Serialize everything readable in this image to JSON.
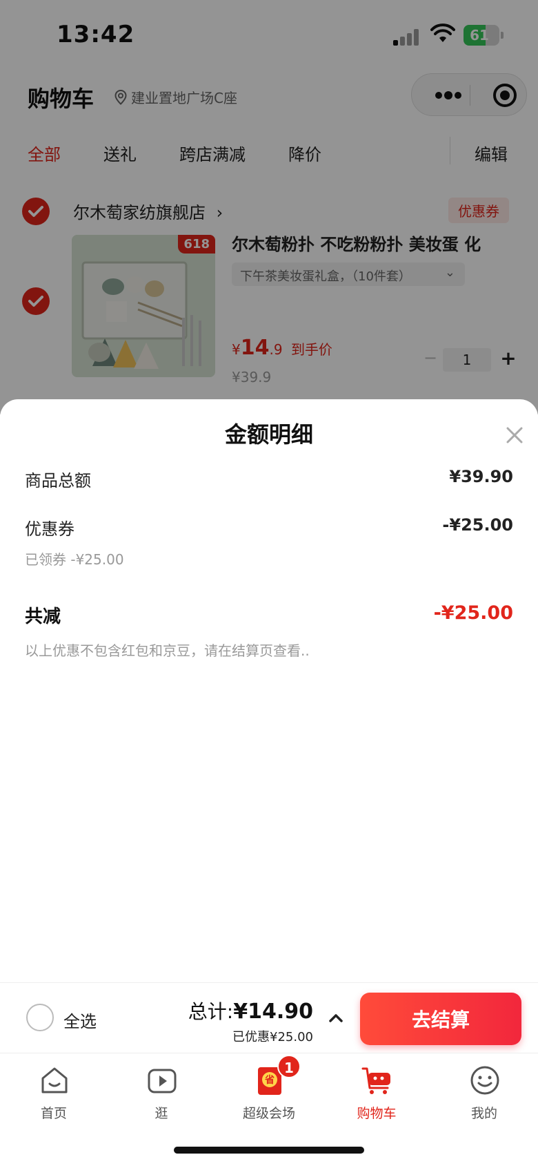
{
  "status_bar": {
    "time": "13:42",
    "battery": "61"
  },
  "header": {
    "title": "购物车",
    "location": "建业置地广场C座"
  },
  "tabs": [
    {
      "label": "全部",
      "active": true
    },
    {
      "label": "送礼",
      "active": false
    },
    {
      "label": "跨店满减",
      "active": false
    },
    {
      "label": "降价",
      "active": false
    }
  ],
  "edit_label": "编辑",
  "shop": {
    "name": "尔木萄家纺旗舰店",
    "coupon_label": "优惠券"
  },
  "item": {
    "badge": "618",
    "title": "尔木萄粉扑 不吃粉粉扑 美妆蛋 化",
    "spec": "下午茶美妆蛋礼盒，（10件套）",
    "price_currency": "¥",
    "price_int": "14",
    "price_dec": ".9",
    "price_suffix": "到手价",
    "original_price": "¥39.9",
    "quantity": "1",
    "minus": "−",
    "plus": "+"
  },
  "sheet": {
    "title": "金额明细",
    "rows": [
      {
        "label": "商品总额",
        "value": "¥39.90"
      },
      {
        "label": "优惠券",
        "value": "-¥25.00",
        "sub": "已领券 -¥25.00"
      }
    ],
    "total": {
      "label": "共减",
      "value": "-¥25.00"
    },
    "note": "以上优惠不包含红包和京豆，请在结算页查看.."
  },
  "checkout": {
    "select_all": "全选",
    "total_prefix": "总计:",
    "total_value": "¥14.90",
    "saved": "已优惠¥25.00",
    "button": "去结算"
  },
  "tabbar": [
    {
      "label": "首页",
      "icon": "home-icon"
    },
    {
      "label": "逛",
      "icon": "video-icon"
    },
    {
      "label": "超级会场",
      "icon": "promo-icon",
      "badge": "1"
    },
    {
      "label": "购物车",
      "icon": "cart-icon",
      "active": true
    },
    {
      "label": "我的",
      "icon": "profile-icon"
    }
  ],
  "colors": {
    "accent": "#e1251b",
    "button_start": "#ff4b3a",
    "button_end": "#f2273c"
  }
}
